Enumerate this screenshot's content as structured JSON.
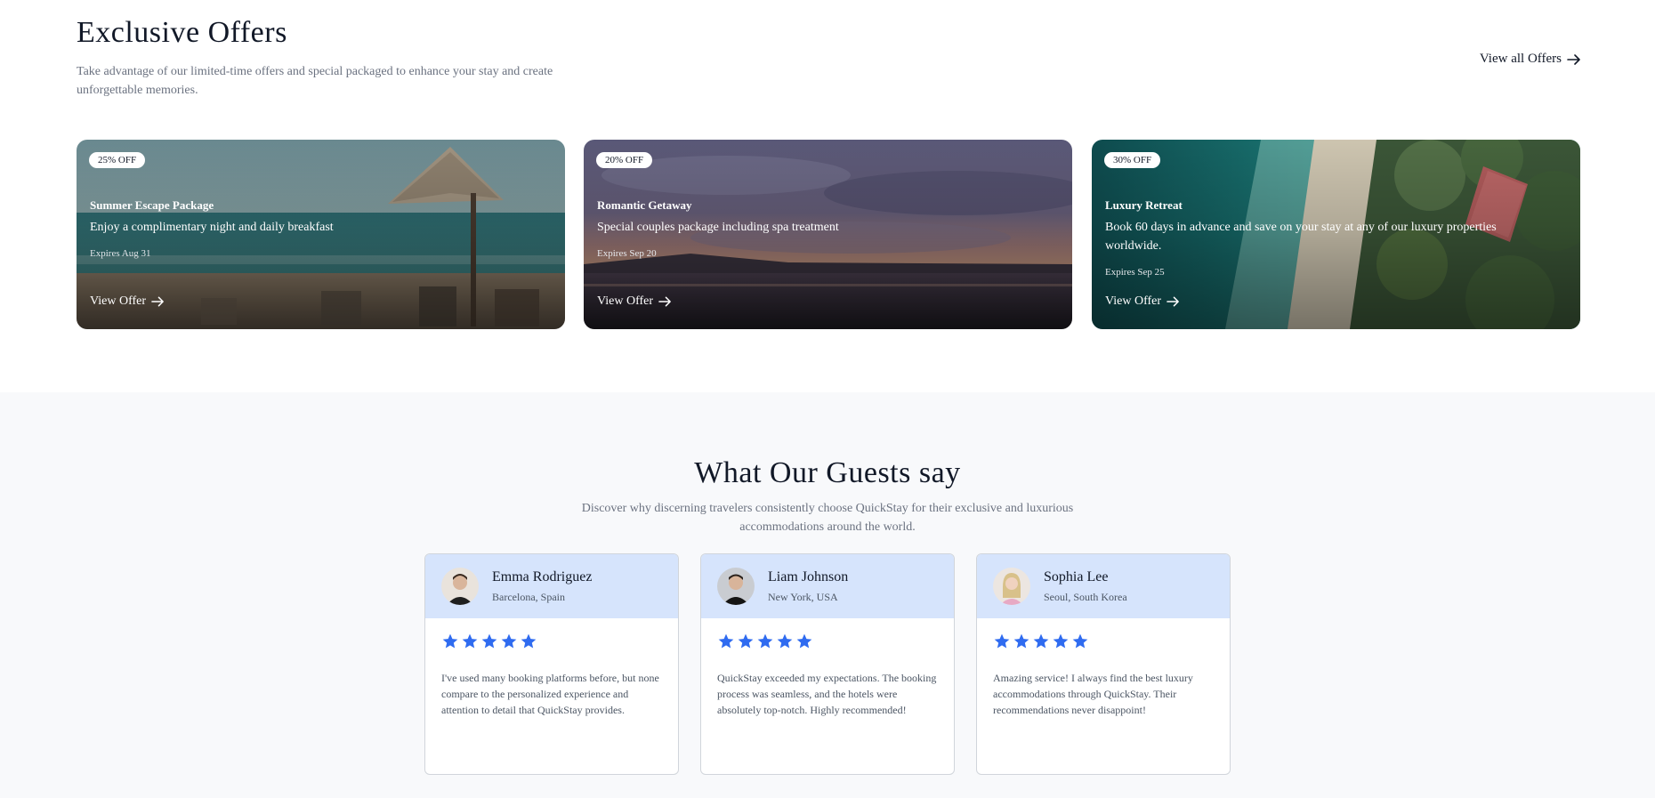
{
  "offers": {
    "title": "Exclusive Offers",
    "subtitle": "Take advantage of our limited-time offers and special packaged to enhance your stay and create unforgettable memories.",
    "view_all_label": "View all Offers",
    "cards": [
      {
        "badge": "25% OFF",
        "name": "Summer Escape Package",
        "description": "Enjoy a complimentary night and daily breakfast",
        "expires": "Expires Aug 31",
        "button": "View Offer"
      },
      {
        "badge": "20% OFF",
        "name": "Romantic Getaway",
        "description": "Special couples package including spa treatment",
        "expires": "Expires Sep 20",
        "button": "View Offer"
      },
      {
        "badge": "30% OFF",
        "name": "Luxury Retreat",
        "description": "Book 60 days in advance and save on your stay at any of our luxury properties worldwide.",
        "expires": "Expires Sep 25",
        "button": "View Offer"
      }
    ]
  },
  "testimonials": {
    "title": "What Our Guests say",
    "subtitle": "Discover why discerning travelers consistently choose QuickStay for their exclusive and luxurious accommodations around the world.",
    "rating_color": "#2f6bf0",
    "reviews": [
      {
        "name": "Emma Rodriguez",
        "location": "Barcelona, Spain",
        "rating": 5,
        "text": "I've used many booking platforms before, but none compare to the personalized experience and attention to detail that QuickStay provides."
      },
      {
        "name": "Liam Johnson",
        "location": "New York, USA",
        "rating": 5,
        "text": "QuickStay exceeded my expectations. The booking process was seamless, and the hotels were absolutely top-notch. Highly recommended!"
      },
      {
        "name": "Sophia Lee",
        "location": "Seoul, South Korea",
        "rating": 5,
        "text": "Amazing service! I always find the best luxury accommodations through QuickStay. Their recommendations never disappoint!"
      }
    ]
  }
}
